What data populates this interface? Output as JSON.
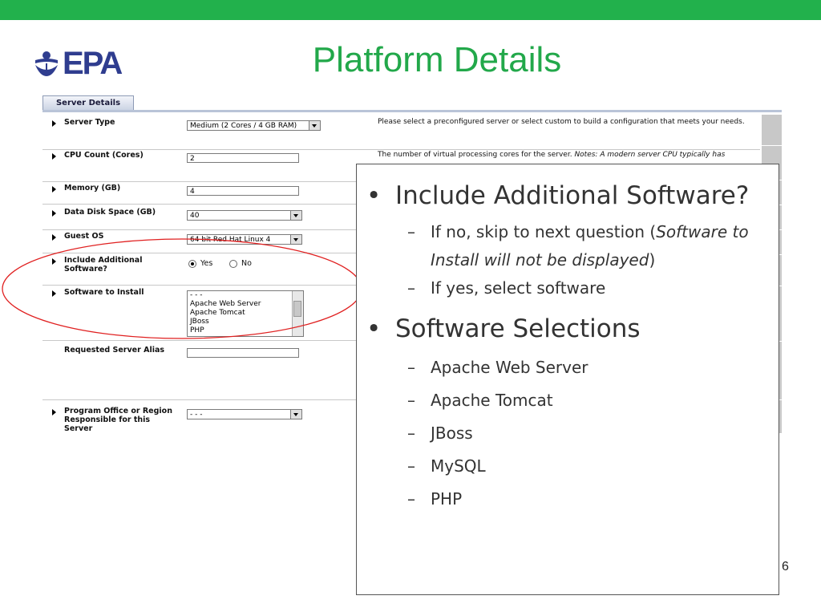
{
  "colors": {
    "accent": "#22b14c",
    "title": "#22a84a",
    "logo": "#2f3d8f",
    "circle": "#e02020"
  },
  "logo": {
    "text": "EPA",
    "icon": "epa-flower-logo"
  },
  "slide": {
    "title": "Platform Details",
    "page_number": "6"
  },
  "form": {
    "tab_label": "Server Details",
    "server_type": {
      "label": "Server Type",
      "value": "Medium (2 Cores / 4 GB RAM)",
      "description": "Please select a preconfigured server or select custom to build a configuration that meets your needs."
    },
    "cpu_count": {
      "label": "CPU Count (Cores)",
      "value": "2",
      "description": "The number of virtual processing cores for the server.",
      "note": "Notes: A modern server CPU typically has"
    },
    "memory": {
      "label": "Memory (GB)",
      "value": "4"
    },
    "data_disk": {
      "label": "Data Disk Space (GB)",
      "value": "40"
    },
    "guest_os": {
      "label": "Guest OS",
      "value": "64 bit Red Hat Linux 4"
    },
    "include_software": {
      "label": "Include Additional Software?",
      "yes_label": "Yes",
      "no_label": "No",
      "selected": "Yes"
    },
    "software_to_install": {
      "label": "Software to Install",
      "options": [
        "- - -",
        "Apache Web Server",
        "Apache Tomcat",
        "JBoss",
        "PHP"
      ]
    },
    "server_alias": {
      "label": "Requested Server Alias",
      "value": ""
    },
    "program_office": {
      "label": "Program Office or Region Responsible for this Server",
      "value": "- - -"
    }
  },
  "overlay": {
    "bullet1": "Include Additional Software?",
    "bullet1_sub1_a": "If no, skip to next question (",
    "bullet1_sub1_italic": "Software to Install will not be displayed",
    "bullet1_sub1_b": ")",
    "bullet1_sub2": "If yes, select software",
    "bullet2": "Software Selections",
    "bullet2_items": [
      "Apache Web Server",
      "Apache Tomcat",
      "JBoss",
      "MySQL",
      "PHP"
    ]
  }
}
